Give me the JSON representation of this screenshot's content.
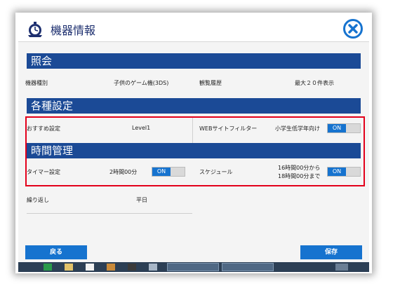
{
  "header": {
    "title": "機器情報"
  },
  "section_inquiry": {
    "title": "照会",
    "device_type_label": "機器種別",
    "device_type_value": "子供のゲーム機(3DS)",
    "history_label": "観覧履歴",
    "history_value": "最大２０件表示"
  },
  "section_settings": {
    "title": "各種設定",
    "recommend_label": "おすすめ設定",
    "recommend_value": "Level1",
    "web_filter_label": "WEBサイトフィルター",
    "web_filter_value": "小学生低学年向け",
    "web_filter_toggle": "ON"
  },
  "section_time": {
    "title": "時間管理",
    "timer_label": "タイマー設定",
    "timer_value": "2時間00分",
    "timer_toggle": "ON",
    "schedule_label": "スケジュール",
    "schedule_from": "16時間00分から",
    "schedule_to": "18時間00分まで",
    "schedule_toggle": "ON",
    "repeat_label": "繰り返し",
    "repeat_value": "平日"
  },
  "footer": {
    "back_label": "戻る",
    "save_label": "保存"
  },
  "colors": {
    "band": "#1b4a96",
    "accent": "#1673cf",
    "highlight": "#e3001b"
  }
}
